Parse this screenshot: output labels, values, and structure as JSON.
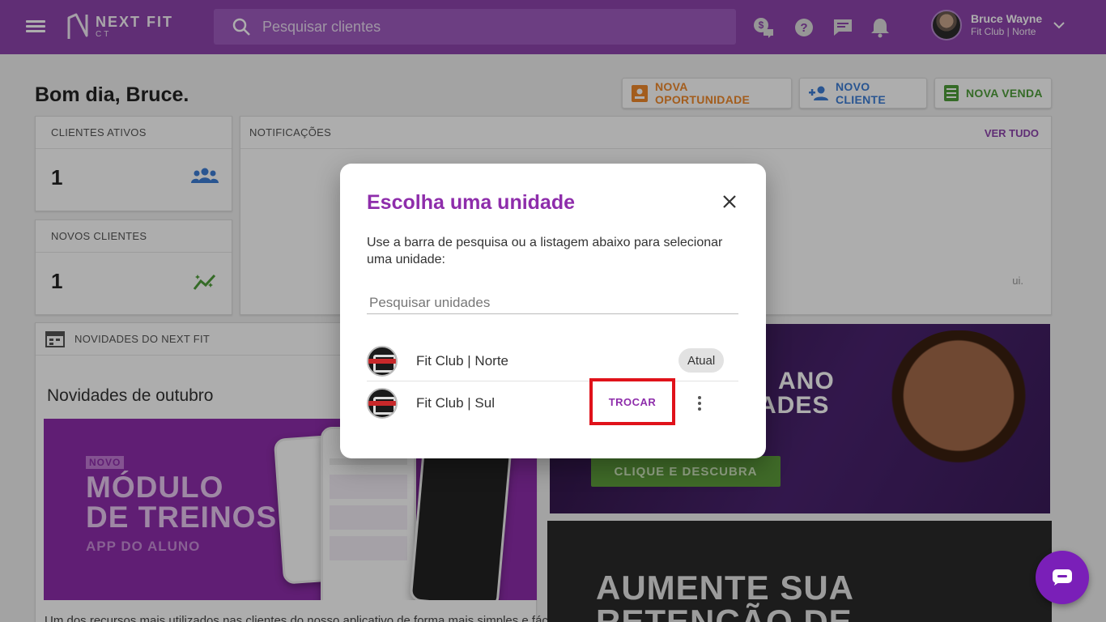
{
  "app": {
    "logo_line1": "NEXT FIT",
    "logo_line2": "CT",
    "search_placeholder": "Pesquisar clientes"
  },
  "header_icons": [
    "money-chat-icon",
    "help-icon",
    "message-icon",
    "bell-icon"
  ],
  "user": {
    "name": "Bruce Wayne",
    "unit": "Fit Club | Norte"
  },
  "dashboard": {
    "greeting": "Bom dia, Bruce.",
    "actions": [
      {
        "label": "NOVA OPORTUNIDADE",
        "color": "#f0892c"
      },
      {
        "label": "NOVO CLIENTE",
        "color": "#3d7ed6"
      },
      {
        "label": "NOVA VENDA",
        "color": "#4f9e3a"
      }
    ],
    "active_clients": {
      "title": "CLIENTES ATIVOS",
      "value": "1"
    },
    "new_clients": {
      "title": "NOVOS CLIENTES",
      "value": "1"
    },
    "notifications": {
      "title": "NOTIFICAÇÕES",
      "see_all": "VER TUDO",
      "empty_fragment": "ui."
    },
    "news": {
      "header": "NOVIDADES DO NEXT FIT",
      "title": "Novidades de outubro",
      "banner_tag": "NOVO",
      "banner_heading_1": "MÓDULO",
      "banner_heading_2": "DE TREINOS",
      "banner_subheading": "APP DO ALUNO",
      "body_fragment": "Um dos recursos mais utilizados nas clientes do nosso aplicativo de forma mais simples e fácil"
    },
    "promo1": {
      "line1": "ANO",
      "line2": "ADES",
      "cta": "CLIQUE E DESCUBRA"
    },
    "promo2": {
      "line1": "AUMENTE SUA",
      "line2": "RETENÇÃO DE"
    }
  },
  "modal": {
    "title": "Escolha uma unidade",
    "description": "Use a barra de pesquisa ou a listagem abaixo para selecionar uma unidade:",
    "search_placeholder": "Pesquisar unidades",
    "units": [
      {
        "name": "Fit Club | Norte",
        "status": "Atual"
      },
      {
        "name": "Fit Club | Sul",
        "action": "TROCAR"
      }
    ]
  },
  "colors": {
    "brand": "#8e44ad",
    "accent_purple": "#8e2dab",
    "highlight_red": "#e0121a"
  }
}
